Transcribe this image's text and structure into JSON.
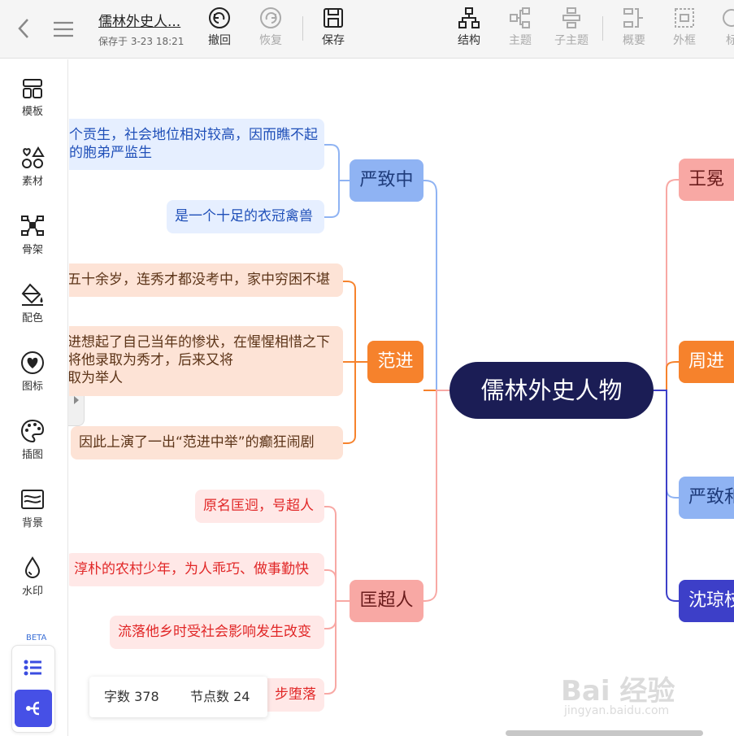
{
  "toolbar": {
    "title": "儒林外史人...",
    "saved": "保存于 3-23 18:21",
    "undo": "撤回",
    "redo": "恢复",
    "save": "保存",
    "structure": "结构",
    "topic": "主题",
    "subtopic": "子主题",
    "summary": "概要",
    "frame": "外框",
    "label_partial": "标"
  },
  "sidebar": {
    "items": [
      {
        "label": "模板",
        "icon": "template-icon"
      },
      {
        "label": "素材",
        "icon": "material-icon"
      },
      {
        "label": "骨架",
        "icon": "skeleton-icon"
      },
      {
        "label": "配色",
        "icon": "paint-bucket-icon"
      },
      {
        "label": "图标",
        "icon": "heart-icon"
      },
      {
        "label": "插图",
        "icon": "palette-icon"
      },
      {
        "label": "背景",
        "icon": "background-icon"
      },
      {
        "label": "水印",
        "icon": "watermark-drop-icon"
      }
    ],
    "beta": "BETA"
  },
  "mindmap": {
    "root": "儒林外史人物",
    "left": [
      {
        "topic": "严致中",
        "leaves": [
          "个贡生，社会地位相对较高，因而瞧不起",
          "的胞弟严监生",
          "是一个十足的衣冠禽兽"
        ]
      },
      {
        "topic": "范进",
        "leaves": [
          "五十余岁，连秀才都没考中，家中穷困不堪",
          "进想起了自己当年的惨状，在惺惺相惜之下",
          "将他录取为秀才，后来又将",
          "取为举人",
          "因此上演了一出“范进中举”的癫狂闹剧"
        ]
      },
      {
        "topic": "匡超人",
        "leaves": [
          "原名匡迥，号超人",
          "淳朴的农村少年，为人乖巧、做事勤快",
          "流落他乡时受社会影响发生改变",
          "步堕落"
        ]
      }
    ],
    "right": [
      "王冕",
      "周进",
      "严致和",
      "沈琼枝"
    ]
  },
  "status": {
    "word_count": "字数 378",
    "node_count": "节点数 24"
  },
  "watermark": {
    "brand": "Bai 经验",
    "url": "jingyan.baidu.com"
  },
  "colors": {
    "root": "#1b1d55",
    "blue": "#8fb3f3",
    "orange": "#f6822c",
    "pink": "#f8a8a4",
    "indigo": "#3d3fc8"
  }
}
